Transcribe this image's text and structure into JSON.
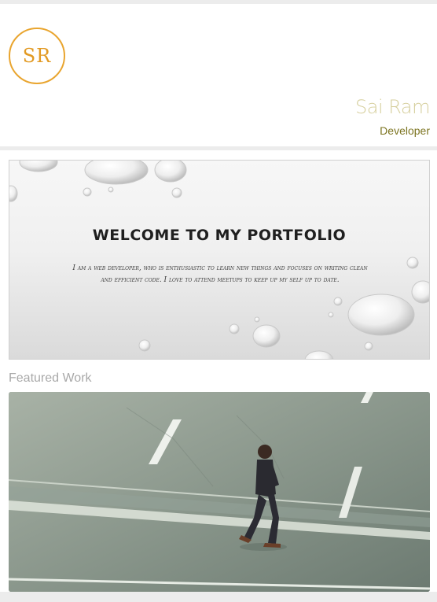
{
  "header": {
    "monogram": "SR",
    "name": "Sai Ram",
    "role": "Developer"
  },
  "banner": {
    "title": "WELCOME TO MY PORTFOLIO",
    "text": "I am a web developer, who is enthusiastic to learn new things and focuses on writing clean and efficient code. I love to attend meetups to keep up my self up to date."
  },
  "featured": {
    "title": "Featured Work"
  },
  "colors": {
    "accent": "#e9a52f",
    "name": "#d6cf9d",
    "role": "#7c7420"
  }
}
